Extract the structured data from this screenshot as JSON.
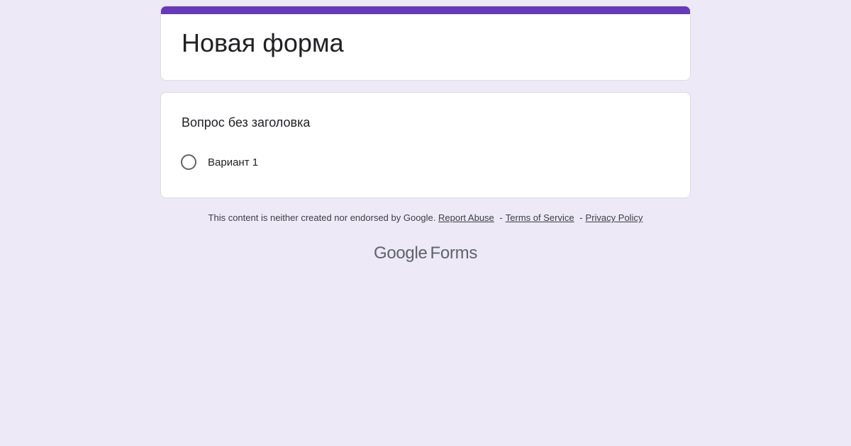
{
  "colors": {
    "background": "#ede9f7",
    "accent": "#673ab7",
    "card": "#ffffff"
  },
  "form": {
    "title": "Новая форма"
  },
  "question": {
    "title": "Вопрос без заголовка",
    "options": [
      {
        "label": "Вариант 1"
      }
    ]
  },
  "footer": {
    "disclaimer": "This content is neither created nor endorsed by Google.",
    "report_abuse": "Report Abuse",
    "terms": "Terms of Service",
    "privacy": "Privacy Policy",
    "separator": "-"
  },
  "brand": {
    "google": "Google",
    "product": "Forms"
  }
}
